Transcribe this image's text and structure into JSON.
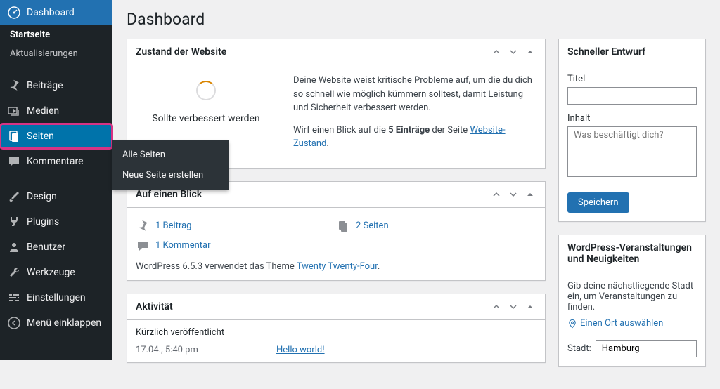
{
  "sidebar": {
    "dashboard": "Dashboard",
    "startseite": "Startseite",
    "aktualisierungen": "Aktualisierungen",
    "beitraege": "Beiträge",
    "medien": "Medien",
    "seiten": "Seiten",
    "kommentare": "Kommentare",
    "design": "Design",
    "plugins": "Plugins",
    "benutzer": "Benutzer",
    "werkzeuge": "Werkzeuge",
    "einstellungen": "Einstellungen",
    "collapse": "Menü einklappen"
  },
  "flyout": {
    "all": "Alle Seiten",
    "new": "Neue Seite erstellen"
  },
  "title": "Dashboard",
  "health": {
    "heading": "Zustand der Website",
    "status": "Sollte verbessert werden",
    "text1": "Deine Website weist kritische Probleme auf, um die du dich so schnell wie möglich kümmern solltest, damit Leistung und Sicherheit verbessert werden.",
    "text2a": "Wirf einen Blick auf die ",
    "text2b": "5 Einträge",
    "text2c": " der Seite ",
    "link": "Website-Zustand",
    "dot": "."
  },
  "glance": {
    "heading": "Auf einen Blick",
    "posts": "1 Beitrag",
    "pages": "2 Seiten",
    "comments": "1 Kommentar",
    "footer_a": "WordPress 6.5.3 verwendet das Theme ",
    "footer_link": "Twenty Twenty-Four",
    "footer_b": "."
  },
  "activity": {
    "heading": "Aktivität",
    "recent": "Kürzlich veröffentlicht",
    "time": "17.04., 5:40 pm",
    "post": "Hello world!"
  },
  "draft": {
    "heading": "Schneller Entwurf",
    "title_label": "Titel",
    "content_label": "Inhalt",
    "placeholder": "Was beschäftigt dich?",
    "save": "Speichern"
  },
  "events": {
    "heading": "WordPress-Veranstaltungen und Neuigkeiten",
    "intro": "Gib deine nächstliegende Stadt ein, um Veranstaltungen zu finden.",
    "loc": "Einen Ort auswählen",
    "city_label": "Stadt:",
    "city_value": "Hamburg"
  }
}
